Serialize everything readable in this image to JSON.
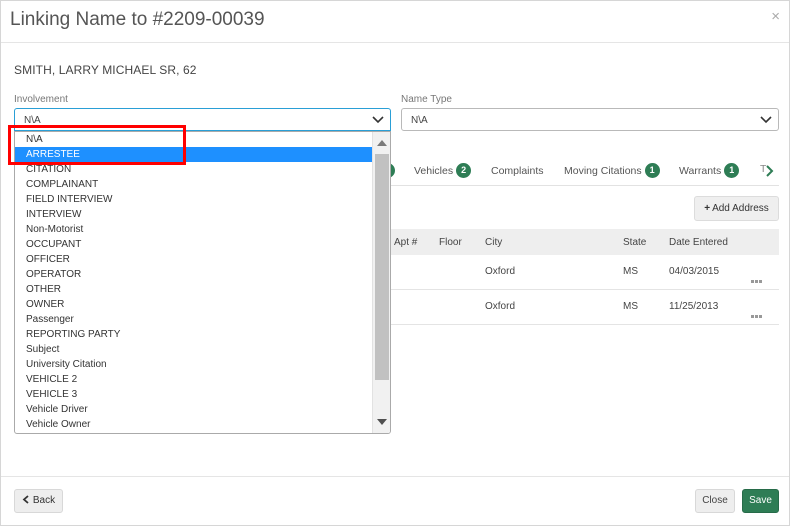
{
  "modal": {
    "title": "Linking Name to #2209-00039",
    "close_glyph": "×"
  },
  "person": {
    "name": "SMITH, LARRY MICHAEL SR, 62"
  },
  "involvement": {
    "label": "Involvement",
    "value": "N\\A",
    "options": [
      "N\\A",
      "ARRESTEE",
      "CITATION",
      "COMPLAINANT",
      "FIELD INTERVIEW",
      "INTERVIEW",
      "Non-Motorist",
      "OCCUPANT",
      "OFFICER",
      "OPERATOR",
      "OTHER",
      "OWNER",
      "Passenger",
      "REPORTING PARTY",
      "Subject",
      "University Citation",
      "VEHICLE 2",
      "VEHICLE 3",
      "Vehicle Driver",
      "Vehicle Owner"
    ],
    "highlighted_option": "ARRESTEE"
  },
  "name_type": {
    "label": "Name Type",
    "value": "N\\A"
  },
  "tabs": [
    {
      "label": "Vehicles",
      "badge": "2"
    },
    {
      "label": "Complaints",
      "badge": ""
    },
    {
      "label": "Moving Citations",
      "badge": "1"
    },
    {
      "label": "Warrants",
      "badge": "1"
    }
  ],
  "tab_cut_label": "T",
  "add_address_label": "Add Address",
  "address_table": {
    "headers": [
      "Apt #",
      "Floor",
      "City",
      "State",
      "Date Entered"
    ],
    "rows": [
      {
        "city": "Oxford",
        "state": "MS",
        "date": "04/03/2015"
      },
      {
        "city": "Oxford",
        "state": "MS",
        "date": "11/25/2013"
      }
    ]
  },
  "footer": {
    "back_label": "Back",
    "close_label": "Close",
    "save_label": "Save"
  },
  "colors": {
    "accent_green": "#2e7d55",
    "selection_blue": "#1e90ff",
    "highlight_red": "#ff0000"
  }
}
